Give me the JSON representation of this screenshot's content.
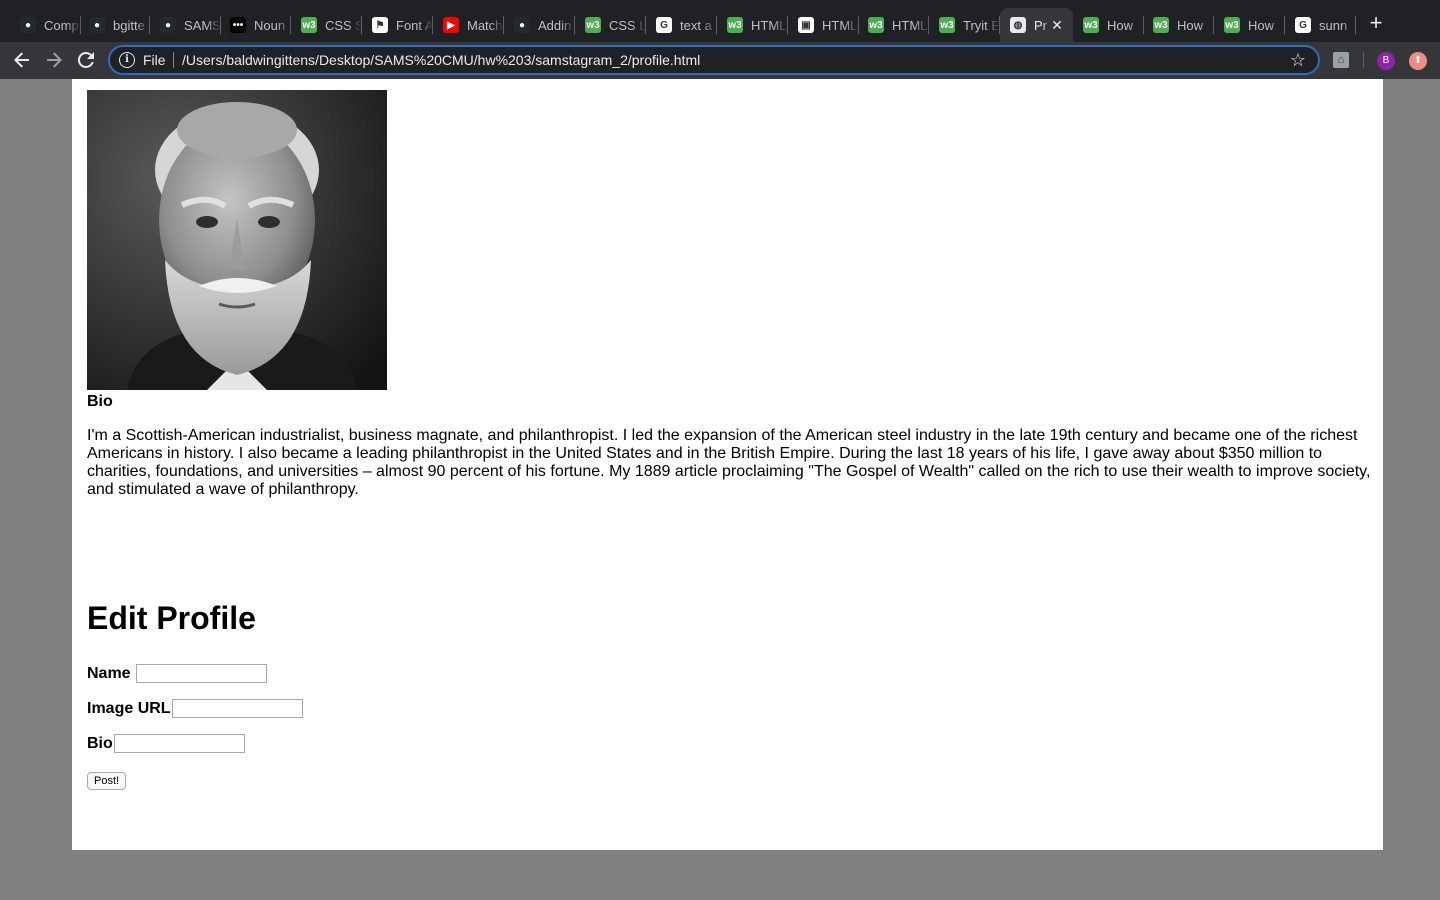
{
  "browser": {
    "tabs": [
      {
        "title": "Comp",
        "icon": "github-icon",
        "color": "#24292e",
        "glyph": "●"
      },
      {
        "title": "bgitte",
        "icon": "github-icon",
        "color": "#24292e",
        "glyph": "●"
      },
      {
        "title": "SAMS",
        "icon": "github-icon",
        "color": "#24292e",
        "glyph": "●"
      },
      {
        "title": "Noun",
        "icon": "noun-project-icon",
        "color": "#000000",
        "glyph": "•••"
      },
      {
        "title": "CSS S",
        "icon": "w3schools-icon",
        "color": "#4caf50",
        "glyph": "w3"
      },
      {
        "title": "Font A",
        "icon": "font-awesome-icon",
        "color": "#ffffff",
        "glyph": "⚑"
      },
      {
        "title": "Match",
        "icon": "youtube-icon",
        "color": "#ff0000",
        "glyph": "▶"
      },
      {
        "title": "Addin",
        "icon": "github-icon",
        "color": "#24292e",
        "glyph": "●"
      },
      {
        "title": "CSS L",
        "icon": "w3schools-icon",
        "color": "#4caf50",
        "glyph": "w3"
      },
      {
        "title": "text a",
        "icon": "google-icon",
        "color": "#ffffff",
        "glyph": "G"
      },
      {
        "title": "HTML",
        "icon": "w3schools-icon",
        "color": "#4caf50",
        "glyph": "w3"
      },
      {
        "title": "HTML",
        "icon": "file-icon",
        "color": "#ffffff",
        "glyph": "▣"
      },
      {
        "title": "HTML",
        "icon": "w3schools-icon",
        "color": "#4caf50",
        "glyph": "w3"
      },
      {
        "title": "Tryit E",
        "icon": "w3schools-icon",
        "color": "#4caf50",
        "glyph": "w3"
      },
      {
        "title": "Pr",
        "icon": "globe-icon",
        "color": "#e8eaed",
        "glyph": "◍",
        "active": true
      },
      {
        "title": "How",
        "icon": "w3schools-icon",
        "color": "#4caf50",
        "glyph": "w3"
      },
      {
        "title": "How",
        "icon": "w3schools-icon",
        "color": "#4caf50",
        "glyph": "w3"
      },
      {
        "title": "How",
        "icon": "w3schools-icon",
        "color": "#4caf50",
        "glyph": "w3"
      },
      {
        "title": "sunn",
        "icon": "google-icon",
        "color": "#ffffff",
        "glyph": "G"
      }
    ],
    "omnibox": {
      "scheme": "File",
      "url": "/Users/baldwingittens/Desktop/SAMS%20CMU/hw%203/samstagram_2/profile.html"
    },
    "profile_initial": "B",
    "accent": "#2f6cbf"
  },
  "page": {
    "bio_heading": "Bio",
    "bio_text": "I'm a Scottish-American industrialist, business magnate, and philanthropist. I led the expansion of the American steel industry in the late 19th century and became one of the richest Americans in history. I also became a leading philanthropist in the United States and in the British Empire. During the last 18 years of his life, I gave away about $350 million to charities, foundations, and universities – almost 90 percent of his fortune. My 1889 article proclaiming \"The Gospel of Wealth\" called on the rich to use their wealth to improve society, and stimulated a wave of philanthropy.",
    "edit_title": "Edit Profile",
    "form": {
      "name_label": "Name",
      "name_value": "",
      "image_label": "Image URL",
      "image_value": "",
      "bio_label": "Bio",
      "bio_value": "",
      "submit_label": "Post!"
    }
  }
}
